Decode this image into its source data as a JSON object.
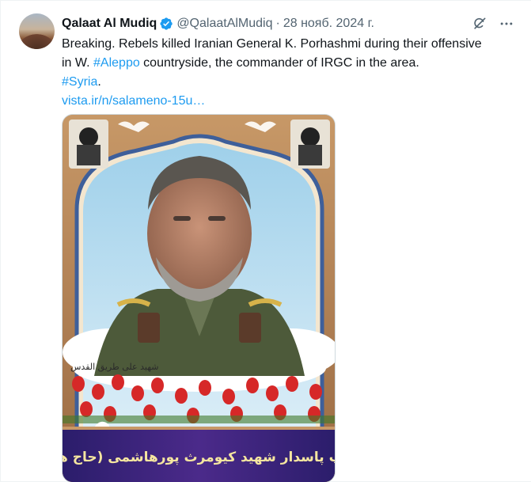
{
  "author": {
    "name": "Qalaat Al Mudiq",
    "handle": "@QalaatAlMudiq",
    "date": "28 нояб. 2024 г.",
    "separator": "·"
  },
  "tweet": {
    "line1": "Breaking. Rebels killed Iranian General K. Porhashmi during their offensive",
    "line2_pre": "in W. ",
    "hashtag_aleppo": "#Aleppo",
    "line2_post": " countryside, the commander of IRGC in the area.",
    "hashtag_syria": "#Syria",
    "syria_suffix": ".",
    "link": "vista.ir/n/salameno-15u…"
  },
  "media": {
    "caption_small": "شهید علی طریق القدس",
    "banner_text": "سرتیپ پاسدار شهید کیومرث پورهاشمی (حاج هاشم)"
  },
  "icons": {
    "verified": "verified-badge-icon",
    "grok": "grok-icon",
    "more": "more-icon"
  },
  "colors": {
    "link": "#1d9bf0",
    "secondary_text": "#536471",
    "verified": "#1d9bf0"
  }
}
